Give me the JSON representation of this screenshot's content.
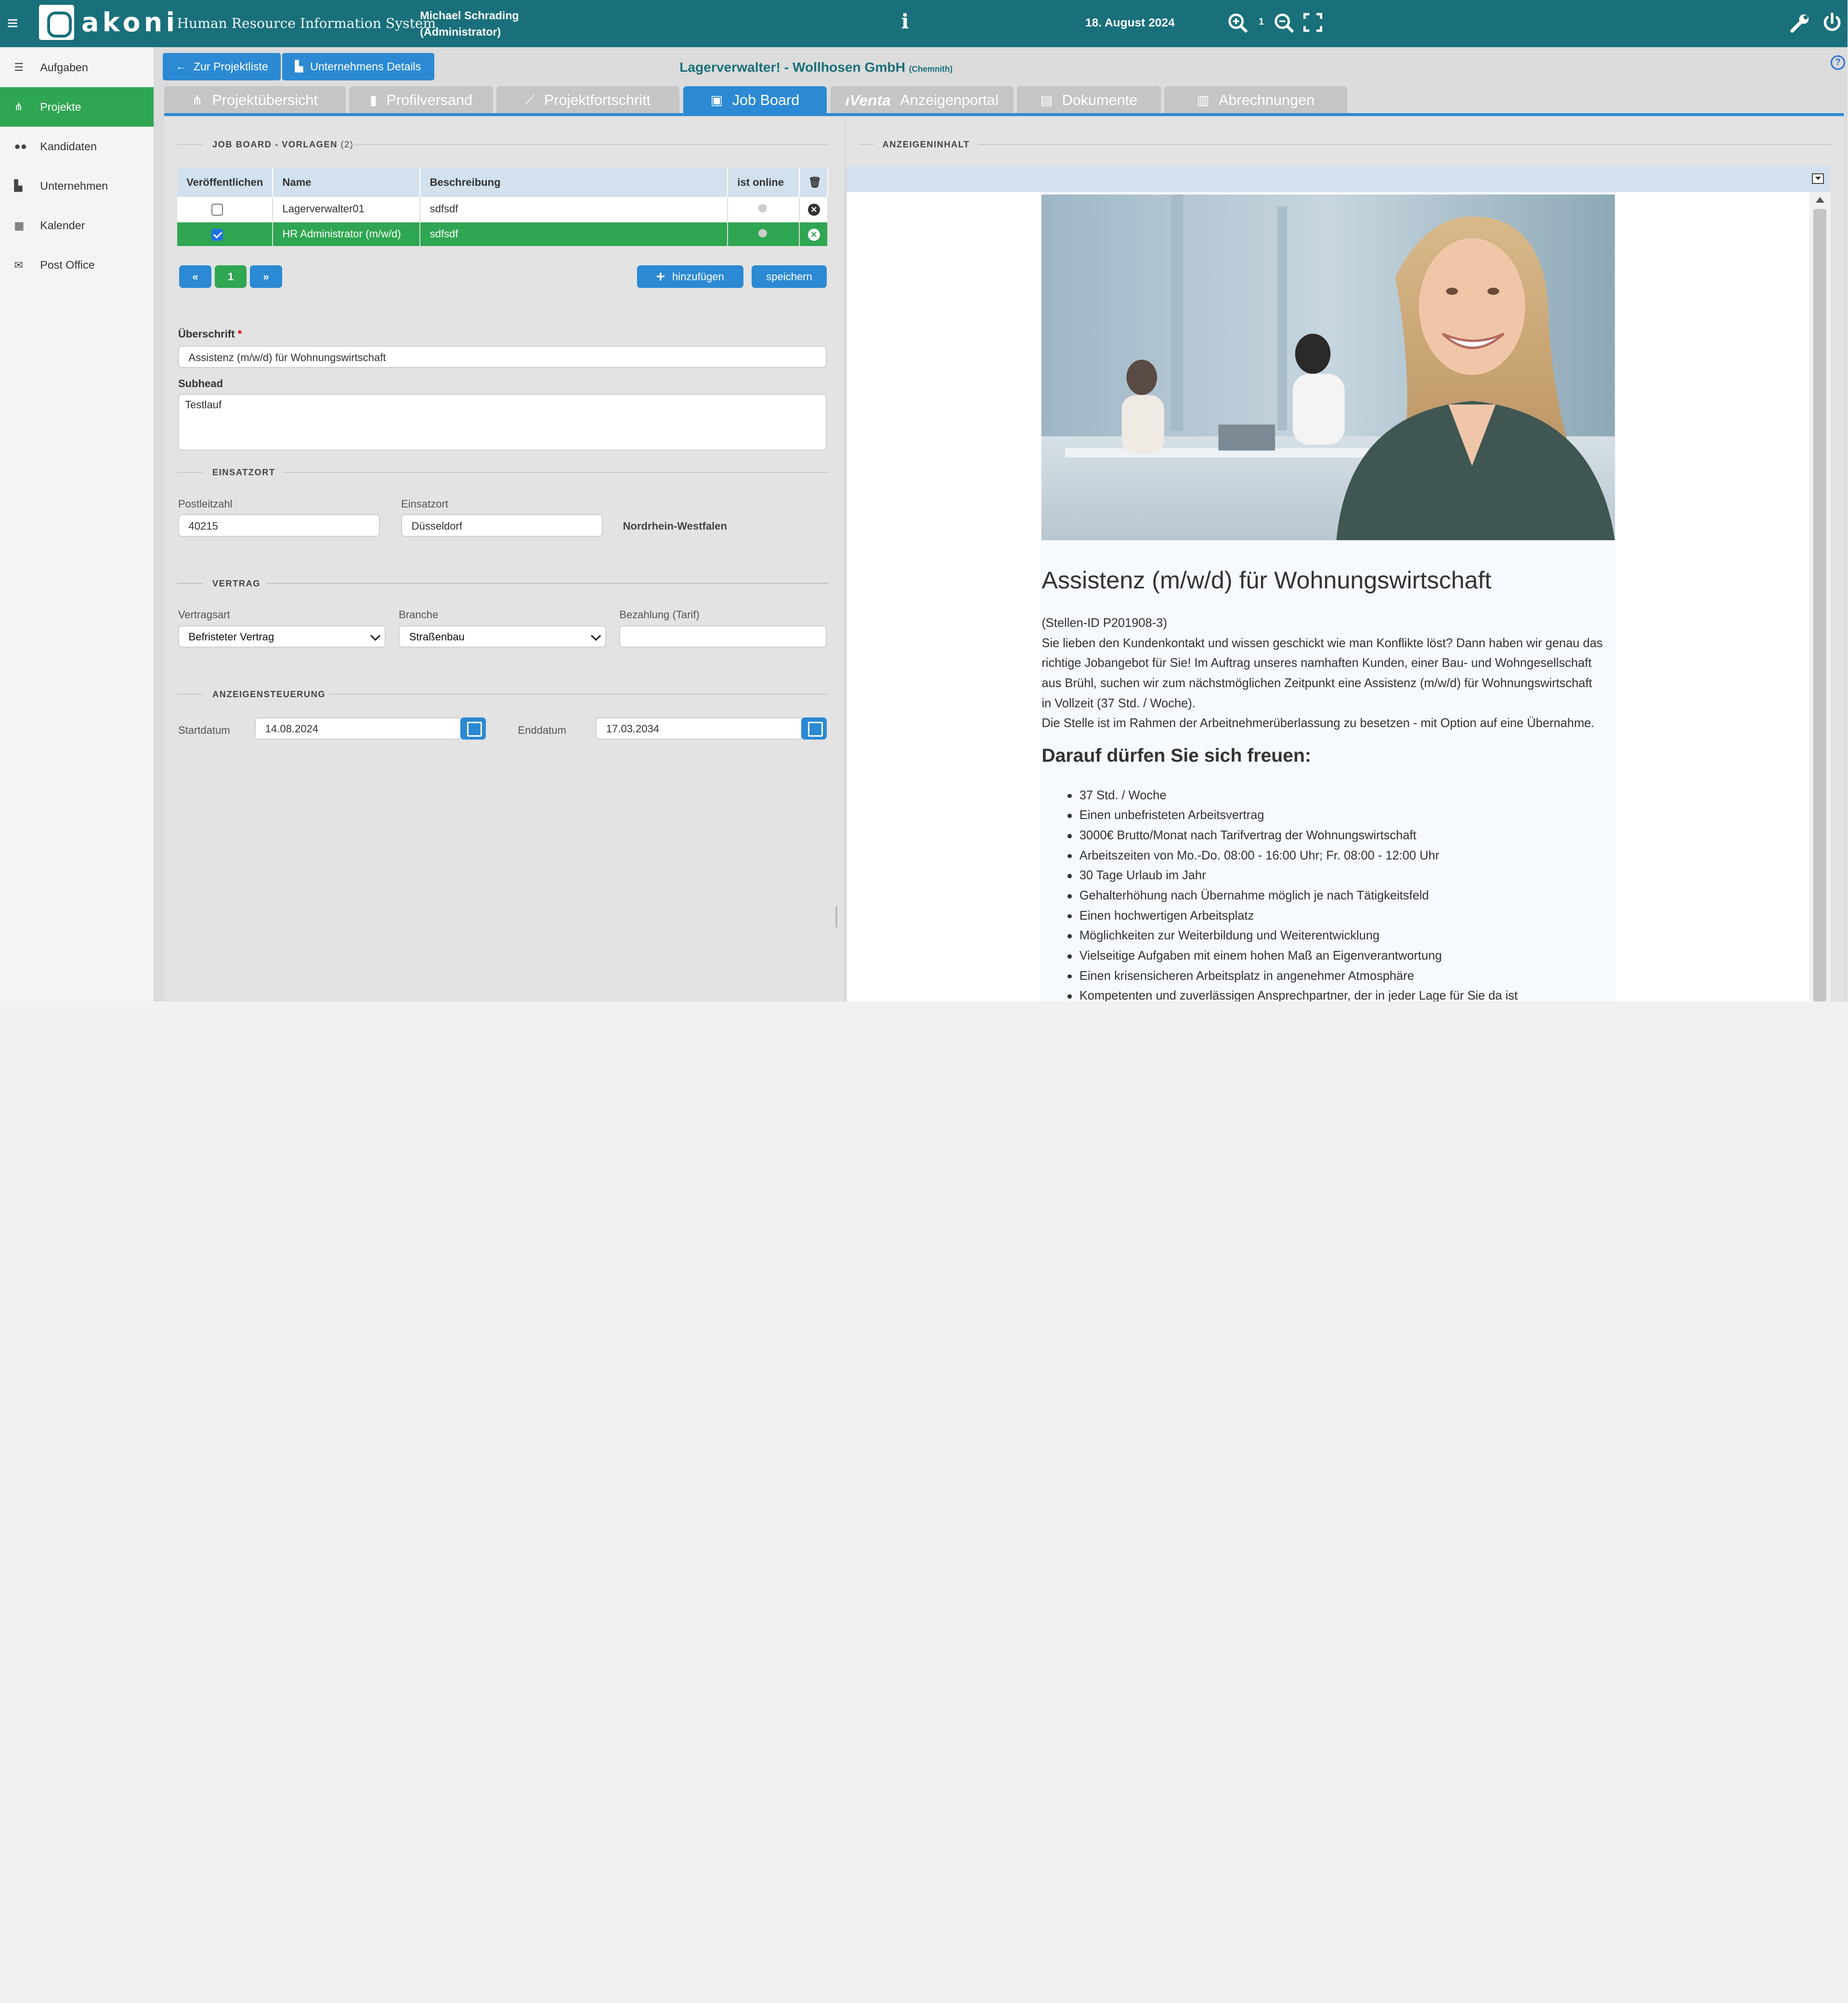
{
  "header": {
    "logo_text": "akoni",
    "subtitle": "Human Resource Information System",
    "user_name": "Michael Schrading",
    "user_role": "(Administrator)",
    "date": "18. August 2024",
    "zoom_level": "1"
  },
  "sidebar": {
    "items": [
      {
        "label": "Aufgaben",
        "icon": "list-icon"
      },
      {
        "label": "Projekte",
        "icon": "sitemap-icon",
        "active": true
      },
      {
        "label": "Kandidaten",
        "icon": "users-icon"
      },
      {
        "label": "Unternehmen",
        "icon": "building-chart-icon"
      },
      {
        "label": "Kalender",
        "icon": "calendar-icon"
      },
      {
        "label": "Post Office",
        "icon": "envelope-icon"
      }
    ]
  },
  "toolbar": {
    "back_label": "Zur Projektliste",
    "company_label": "Unternehmens Details",
    "project_title": "Lagerverwalter! - Wollhosen GmbH",
    "project_city": "(Chemnith)"
  },
  "tabs": [
    {
      "label": "Projektübersicht",
      "icon": "sitemap-icon"
    },
    {
      "label": "Profilversand",
      "icon": "file-icon"
    },
    {
      "label": "Projektfortschritt",
      "icon": "chart-icon"
    },
    {
      "label": "Job Board",
      "icon": "ad-icon",
      "active": true
    },
    {
      "label": "Anzeigenportal",
      "brand": "ıVenta"
    },
    {
      "label": "Dokumente",
      "icon": "document-icon"
    },
    {
      "label": "Abrechnungen",
      "icon": "invoice-icon"
    }
  ],
  "templates": {
    "section_title": "JOB BOARD - VORLAGEN",
    "count": "(2)",
    "columns": [
      "Veröffentlichen",
      "Name",
      "Beschreibung",
      "ist online"
    ],
    "rows": [
      {
        "published": false,
        "name": "Lagerverwalter01",
        "description": "sdfsdf"
      },
      {
        "published": true,
        "name": "HR Administrator (m/w/d)",
        "description": "sdfsdf"
      }
    ],
    "page": "1",
    "add_label": "hinzufügen",
    "save_label": "speichern"
  },
  "form": {
    "heading_label": "Überschrift",
    "heading_required": "*",
    "heading_value": "Assistenz (m/w/d) für Wohnungswirtschaft",
    "subhead_label": "Subhead",
    "subhead_value": "Testlauf",
    "location_section": "EINSATZORT",
    "zip_label": "Postleitzahl",
    "zip_value": "40215",
    "place_label": "Einsatzort",
    "place_value": "Düsseldorf",
    "state": "Nordrhein-Westfalen",
    "contract_section": "VERTRAG",
    "contract_type_label": "Vertragsart",
    "contract_type_value": "Befristeter Vertrag",
    "branch_label": "Branche",
    "branch_value": "Straßenbau",
    "pay_label": "Bezahlung (Tarif)",
    "pay_value": "",
    "ad_control_section": "ANZEIGENSTEUERUNG",
    "start_label": "Startdatum",
    "start_value": "14.08.2024",
    "end_label": "Enddatum",
    "end_value": "17.03.2034"
  },
  "ad": {
    "section_title": "ANZEIGENINHALT",
    "title": "Assistenz (m/w/d) für Wohnungswirtschaft",
    "stellen_id": "(Stellen-ID P201908-3)",
    "intro_lines": [
      "Sie lieben den Kundenkontakt und wissen geschickt wie man Konflikte löst? Dann haben wir genau das",
      "richtige Jobangebot für Sie! Im Auftrag unseres namhaften Kunden, einer Bau- und Wohngesellschaft",
      "aus Brühl, suchen wir zum nächstmöglichen Zeitpunkt eine Assistenz (m/w/d) für Wohnungswirtschaft",
      "in Vollzeit (37 Std. / Woche).",
      "Die Stelle ist im Rahmen der Arbeitnehmerüberlassung zu besetzen - mit Option auf eine Übernahme."
    ],
    "benefits_title": "Darauf dürfen Sie sich freuen:",
    "benefits": [
      "37 Std. / Woche",
      "Einen unbefristeten Arbeitsvertrag",
      "3000€ Brutto/Monat nach Tarifvertrag der Wohnungswirtschaft",
      "Arbeitszeiten von Mo.-Do. 08:00 - 16:00 Uhr; Fr. 08:00 - 12:00 Uhr",
      "30 Tage Urlaub im Jahr",
      "Gehalterhöhung nach Übernahme möglich je nach Tätigkeitsfeld",
      "Einen hochwertigen Arbeitsplatz",
      "Möglichkeiten zur Weiterbildung und Weiterentwicklung",
      "Vielseitige Aufgaben mit einem hohen Maß an Eigenverantwortung",
      "Einen krisensicheren Arbeitsplatz in angenehmer Atmosphäre",
      "Kompetenten und zuverlässigen Ansprechpartner, der in jeder Lage für Sie da ist"
    ]
  },
  "colors": {
    "header": "#19707a",
    "accent_blue": "#2b8ad3",
    "active_green": "#2fa652"
  }
}
